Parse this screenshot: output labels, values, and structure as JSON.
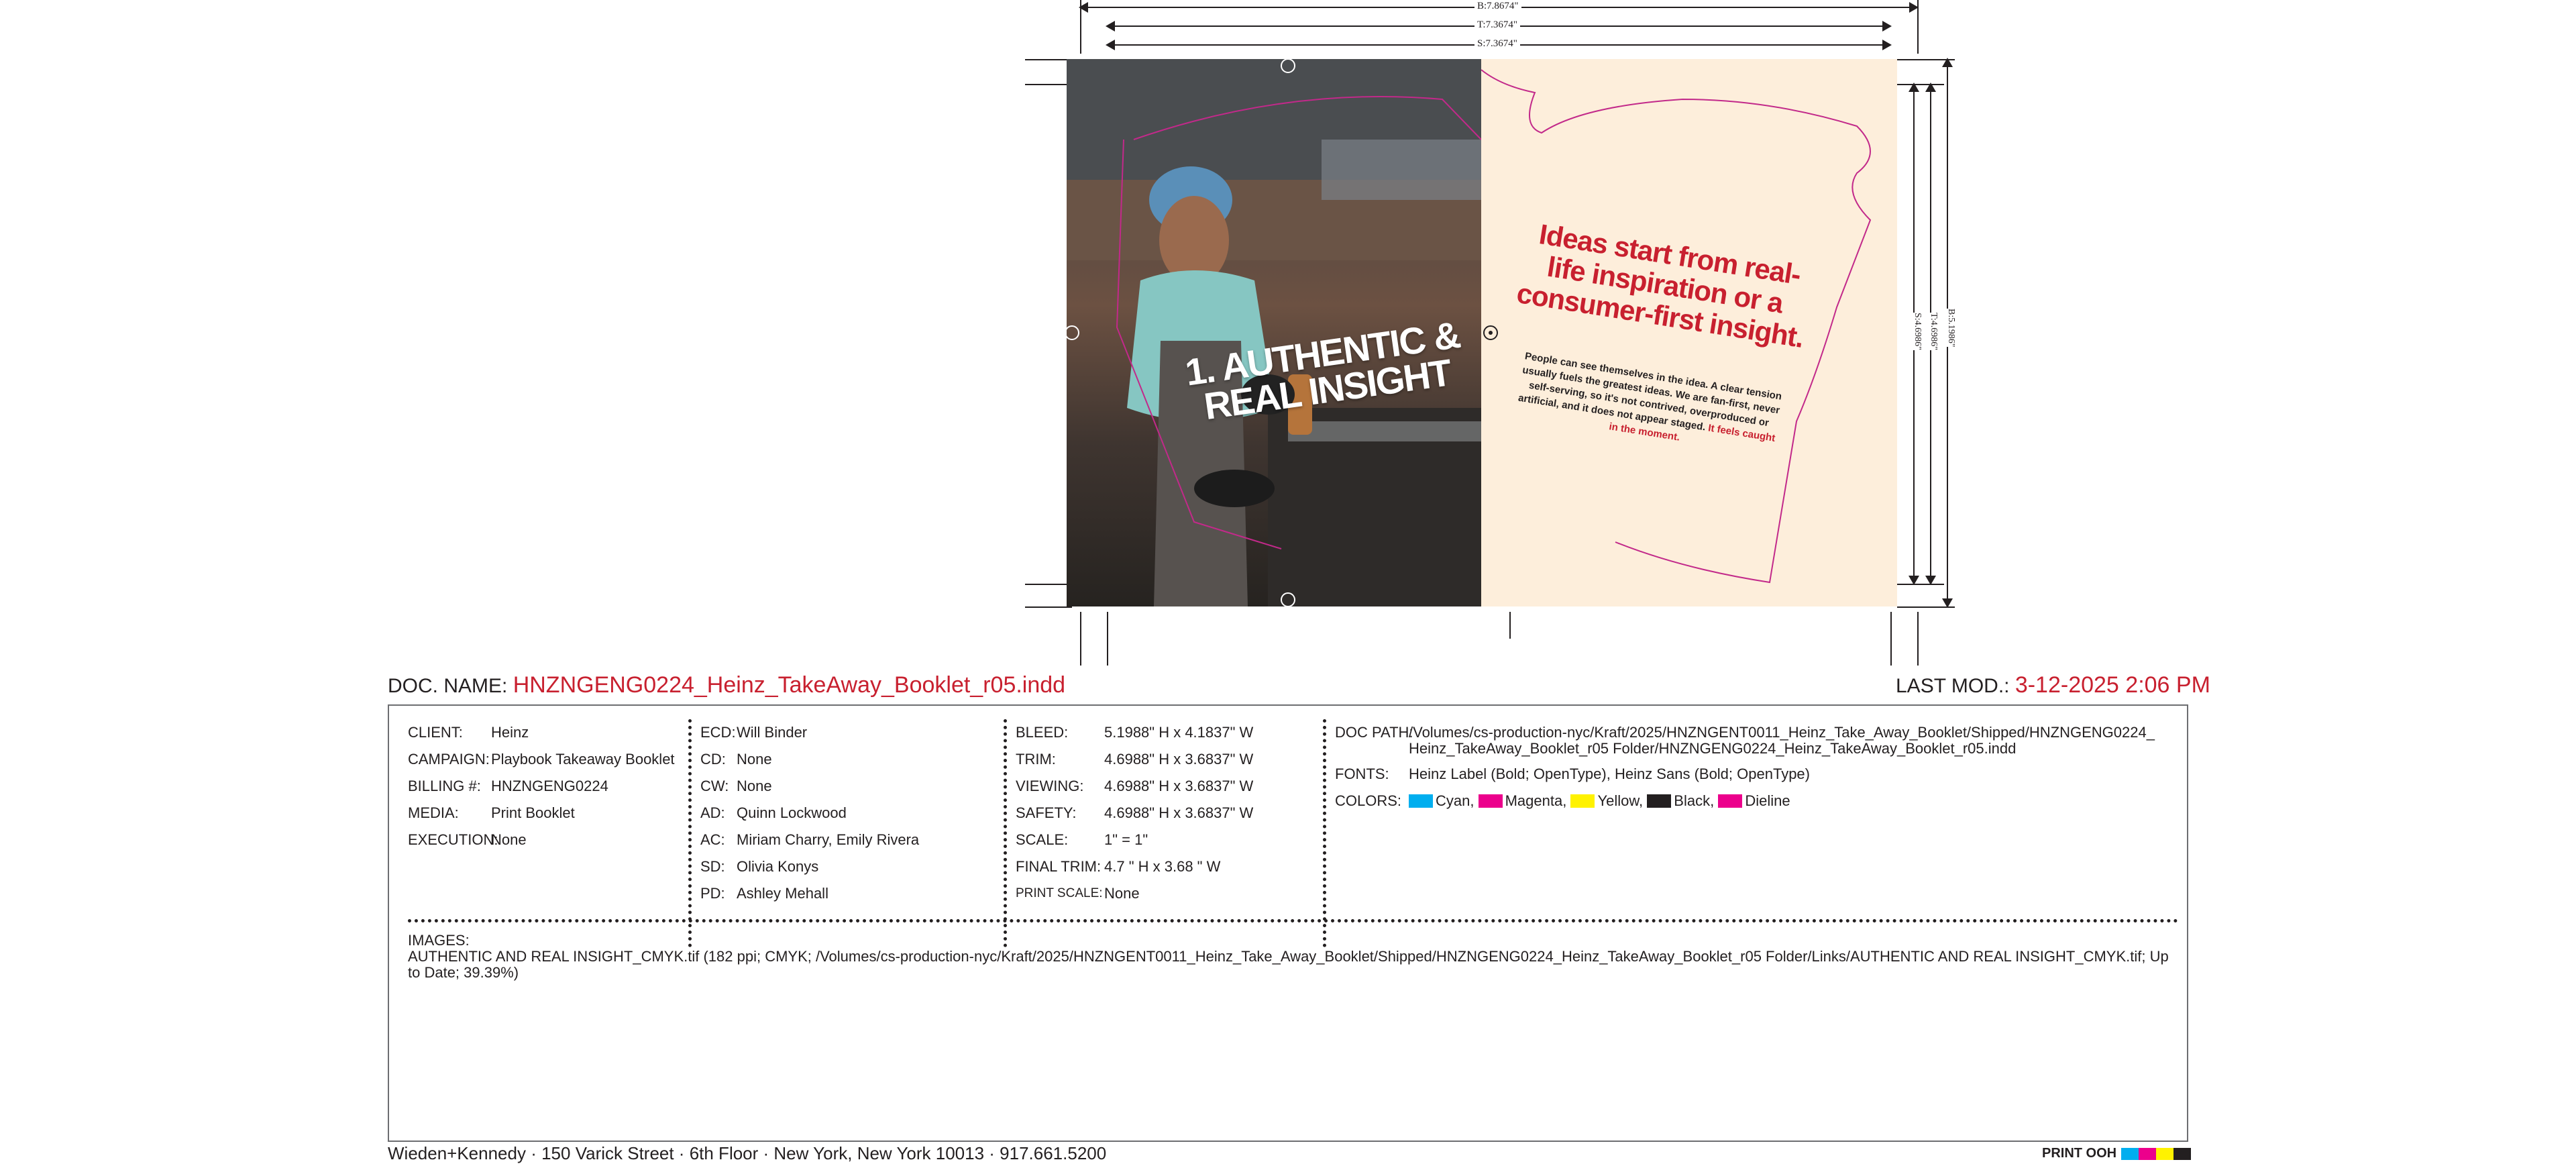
{
  "dimensions": {
    "b_width": "B:7.8674\"",
    "t_width": "T:7.3674\"",
    "s_width": "S:7.3674\"",
    "b_height": "B:5.1986\"",
    "t_height": "T:4.6986\"",
    "s_height": "S:4.6986\""
  },
  "artwork": {
    "left_headline_line1": "1. AUTHENTIC &",
    "left_headline_line2": "REAL INSIGHT",
    "panel_headline": "Ideas start from real-life inspiration or a consumer-first insight.",
    "panel_body": "People can see themselves in the idea. A clear tension usually fuels the greatest ideas. We are fan-first, never self-serving, so it's not contrived, overproduced or artificial, and it does not appear staged.",
    "panel_body_highlight": "It feels caught in the moment.",
    "photo_icon": "chef-photo",
    "colors": {
      "panel_bg": "#fdeedb",
      "headline_red": "#c8202f",
      "dieline": "#c2298a"
    }
  },
  "slug": {
    "doc_name_label": "DOC. NAME:",
    "doc_name_value": "HNZNGENG0224_Heinz_TakeAway_Booklet_r05.indd",
    "last_mod_label": "LAST MOD.:",
    "last_mod_value": "3-12-2025 2:06 PM",
    "col1": [
      {
        "k": "CLIENT:",
        "v": "Heinz"
      },
      {
        "k": "CAMPAIGN:",
        "v": "Playbook Takeaway Booklet"
      },
      {
        "k": "BILLING #:",
        "v": "HNZNGENG0224"
      },
      {
        "k": "MEDIA:",
        "v": "Print Booklet"
      },
      {
        "k": "EXECUTION:",
        "v": "None"
      }
    ],
    "col2": [
      {
        "k": "ECD:",
        "v": "Will Binder"
      },
      {
        "k": "CD:",
        "v": "None"
      },
      {
        "k": "CW:",
        "v": "None"
      },
      {
        "k": "AD:",
        "v": "Quinn Lockwood"
      },
      {
        "k": "AC:",
        "v": "Miriam Charry, Emily Rivera"
      },
      {
        "k": "SD:",
        "v": "Olivia Konys"
      },
      {
        "k": "PD:",
        "v": "Ashley Mehall"
      }
    ],
    "col3": [
      {
        "k": "BLEED:",
        "v": "5.1988\" H x 4.1837\" W"
      },
      {
        "k": "TRIM:",
        "v": "4.6988\" H x 3.6837\" W"
      },
      {
        "k": "VIEWING:",
        "v": "4.6988\" H x 3.6837\" W"
      },
      {
        "k": "SAFETY:",
        "v": "4.6988\" H x 3.6837\" W"
      },
      {
        "k": "SCALE:",
        "v": "1\" = 1\""
      },
      {
        "k": "FINAL TRIM:",
        "v": "4.7 \" H x 3.68 \" W"
      },
      {
        "k": "PRINT SCALE:",
        "v": "None"
      }
    ],
    "doc_path_label": "DOC PATH:",
    "doc_path_line1": "/Volumes/cs-production-nyc/Kraft/2025/HNZNGENT0011_Heinz_Take_Away_Booklet/Shipped/HNZNGENG0224_",
    "doc_path_line2": "Heinz_TakeAway_Booklet_r05 Folder/HNZNGENG0224_Heinz_TakeAway_Booklet_r05.indd",
    "fonts_label": "FONTS:",
    "fonts_value": "Heinz Label (Bold; OpenType), Heinz Sans (Bold; OpenType)",
    "colors_label": "COLORS:",
    "colors": [
      {
        "name": "Cyan,",
        "hex": "#00aeef"
      },
      {
        "name": "Magenta,",
        "hex": "#ec008c"
      },
      {
        "name": "Yellow,",
        "hex": "#fff200"
      },
      {
        "name": "Black,",
        "hex": "#231f20"
      },
      {
        "name": "Dieline",
        "hex": "#ec008c"
      }
    ],
    "images_label": "IMAGES:",
    "images_value": "AUTHENTIC AND REAL INSIGHT_CMYK.tif (182 ppi; CMYK; /Volumes/cs-production-nyc/Kraft/2025/HNZNGENT0011_Heinz_Take_Away_Booklet/Shipped/HNZNGENG0224_Heinz_TakeAway_Booklet_r05 Folder/Links/AUTHENTIC AND REAL INSIGHT_CMYK.tif; Up to Date; 39.39%)"
  },
  "footer": {
    "agency": "Wieden+Kennedy · 150 Varick Street · 6th Floor · New York, New York 10013 · 917.661.5200",
    "print_label": "PRINT OOH",
    "swatches": [
      "#00aeef",
      "#ec008c",
      "#fff200",
      "#231f20"
    ]
  }
}
